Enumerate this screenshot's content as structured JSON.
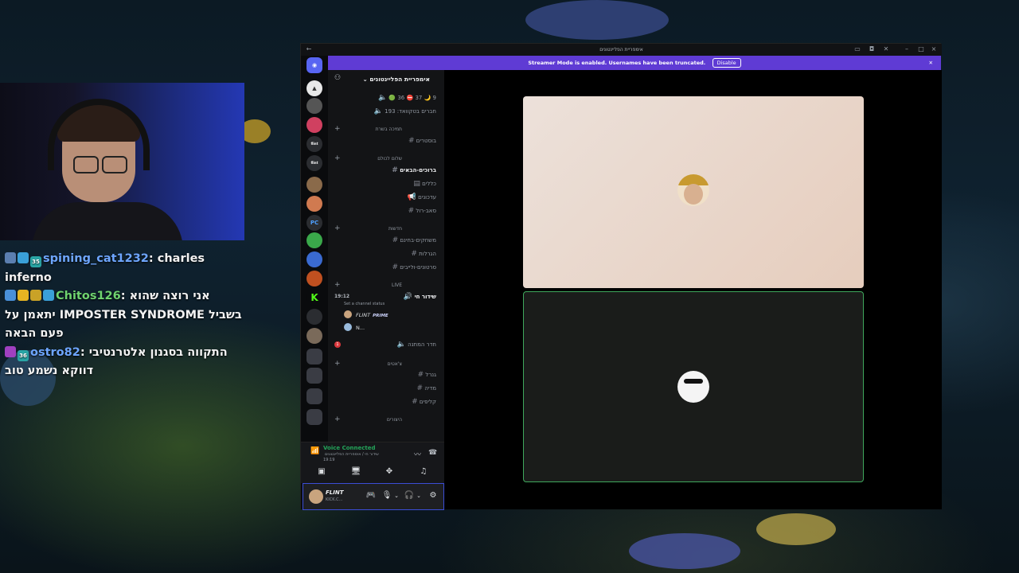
{
  "window": {
    "title": "אימפריית הפליינטונים"
  },
  "banner": {
    "text": "Streamer Mode is enabled. Usernames have been truncated.",
    "disable_label": "Disable",
    "close_icon": "close-icon"
  },
  "stream_chat": [
    {
      "user": "spining_cat1232",
      "message": ": charles inferno",
      "user_color": "#6ea6ff",
      "sub_months": "35"
    },
    {
      "user": "Chitos126",
      "message": ": אני רוצה שהוא יתאמן על IMPOSTER SYNDROME בשביל פעם הבאה",
      "user_color": "#6fd36f"
    },
    {
      "user": "ostro82",
      "message": ": התקווה בסגנון אלטרנטיבי דווקא נשמע טוב",
      "user_color": "#6ea6ff",
      "sub_months": "36"
    }
  ],
  "server": {
    "name": "אימפריית הפליינטונים",
    "stats_counts": "9 🌙 37 ⛔ 36 🟢",
    "members_label": "חברים בטקוואד: 193"
  },
  "categories": [
    {
      "label": "תמיכה בשרת",
      "channels": [
        {
          "name": "בוסטרים"
        }
      ]
    },
    {
      "label": "שלום לכולם",
      "channels": [
        {
          "name": "ברוכים-הבאים"
        },
        {
          "name": "כללים"
        },
        {
          "name": "עדכונים"
        },
        {
          "name": "סאב-רול"
        }
      ]
    },
    {
      "label": "חדשות",
      "channels": [
        {
          "name": "משחקים-בחינם"
        },
        {
          "name": "הגרלות"
        },
        {
          "name": "סרטונים-ולייבים"
        }
      ]
    },
    {
      "label": "LIVE",
      "channels": [
        {
          "name": "שידור חי",
          "time": "19:12",
          "status": "Set a channel status"
        },
        {
          "name": "חדר המתנה",
          "badge": "1"
        }
      ]
    },
    {
      "label": "צ'אטים",
      "channels": [
        {
          "name": "גנרל"
        },
        {
          "name": "מדיה"
        },
        {
          "name": "קליפים"
        }
      ]
    },
    {
      "label": "היצורים",
      "channels": []
    }
  ],
  "voice_users": [
    {
      "name": "FLINT",
      "tag": "PRIME"
    },
    {
      "name": "N..."
    }
  ],
  "voice_panel": {
    "status": "Voice Connected",
    "channel": "שידור חי / אימפריית הפליינטונים",
    "elapsed": "19:19"
  },
  "user_panel": {
    "name": "FLINT",
    "status": "KICK.C..."
  },
  "colors": {
    "accent": "#5f3bd4",
    "voice_green": "#23a55a",
    "speaking_border": "#3fa85c"
  }
}
